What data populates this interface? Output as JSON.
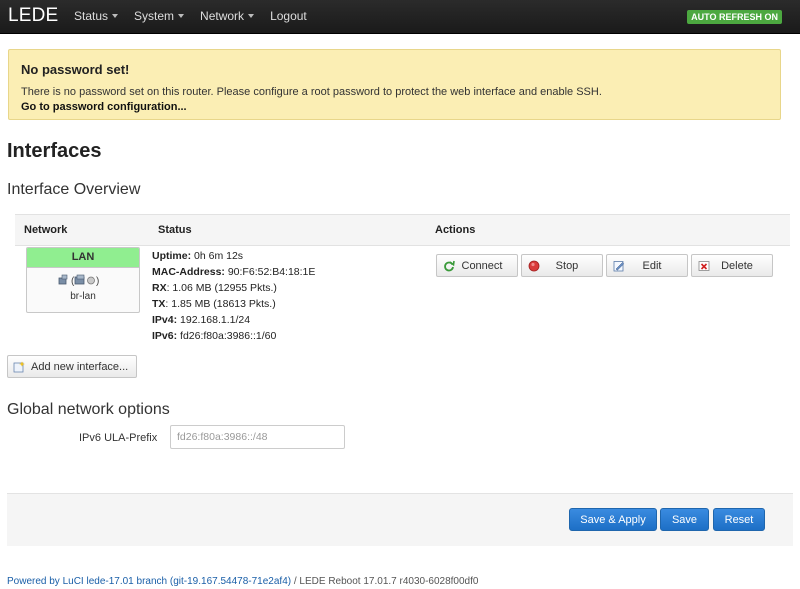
{
  "header": {
    "brand": "LEDE",
    "nav": [
      {
        "label": "Status",
        "dropdown": true
      },
      {
        "label": "System",
        "dropdown": true
      },
      {
        "label": "Network",
        "dropdown": true
      },
      {
        "label": "Logout",
        "dropdown": false
      }
    ],
    "refresh_badge": "AUTO REFRESH ON"
  },
  "alert": {
    "title": "No password set!",
    "text": "There is no password set on this router. Please configure a root password to protect the web interface and enable SSH.",
    "link": "Go to password configuration..."
  },
  "page_title": "Interfaces",
  "overview": {
    "title": "Interface Overview",
    "columns": {
      "network": "Network",
      "status": "Status",
      "actions": "Actions"
    },
    "interface": {
      "name": "LAN",
      "device": "br-lan",
      "status": [
        {
          "label": "Uptime:",
          "value": " 0h 6m 12s"
        },
        {
          "label": "MAC-Address:",
          "value": " 90:F6:52:B4:18:1E"
        },
        {
          "label": "RX",
          "value": ": 1.06 MB (12955 Pkts.)"
        },
        {
          "label": "TX",
          "value": ": 1.85 MB (18613 Pkts.)"
        },
        {
          "label": "IPv4:",
          "value": " 192.168.1.1/24"
        },
        {
          "label": "IPv6:",
          "value": " fd26:f80a:3986::1/60"
        }
      ],
      "actions": {
        "connect": "Connect",
        "stop": "Stop",
        "edit": "Edit",
        "delete": "Delete"
      }
    },
    "add_button": "Add new interface..."
  },
  "global": {
    "title": "Global network options",
    "ula_label": "IPv6 ULA-Prefix",
    "ula_value": "fd26:f80a:3986::/48"
  },
  "buttons": {
    "save_apply": "Save & Apply",
    "save": "Save",
    "reset": "Reset"
  },
  "footer": {
    "link": "Powered by LuCI lede-17.01 branch (git-19.167.54478-71e2af4)",
    "text": " / LEDE Reboot 17.01.7 r4030-6028f00df0"
  },
  "colors": {
    "lan_header": "#90ee90",
    "primary_button": "#1d6fc6",
    "refresh_badge": "#4ca840",
    "alert_bg": "#fbeeb4"
  }
}
